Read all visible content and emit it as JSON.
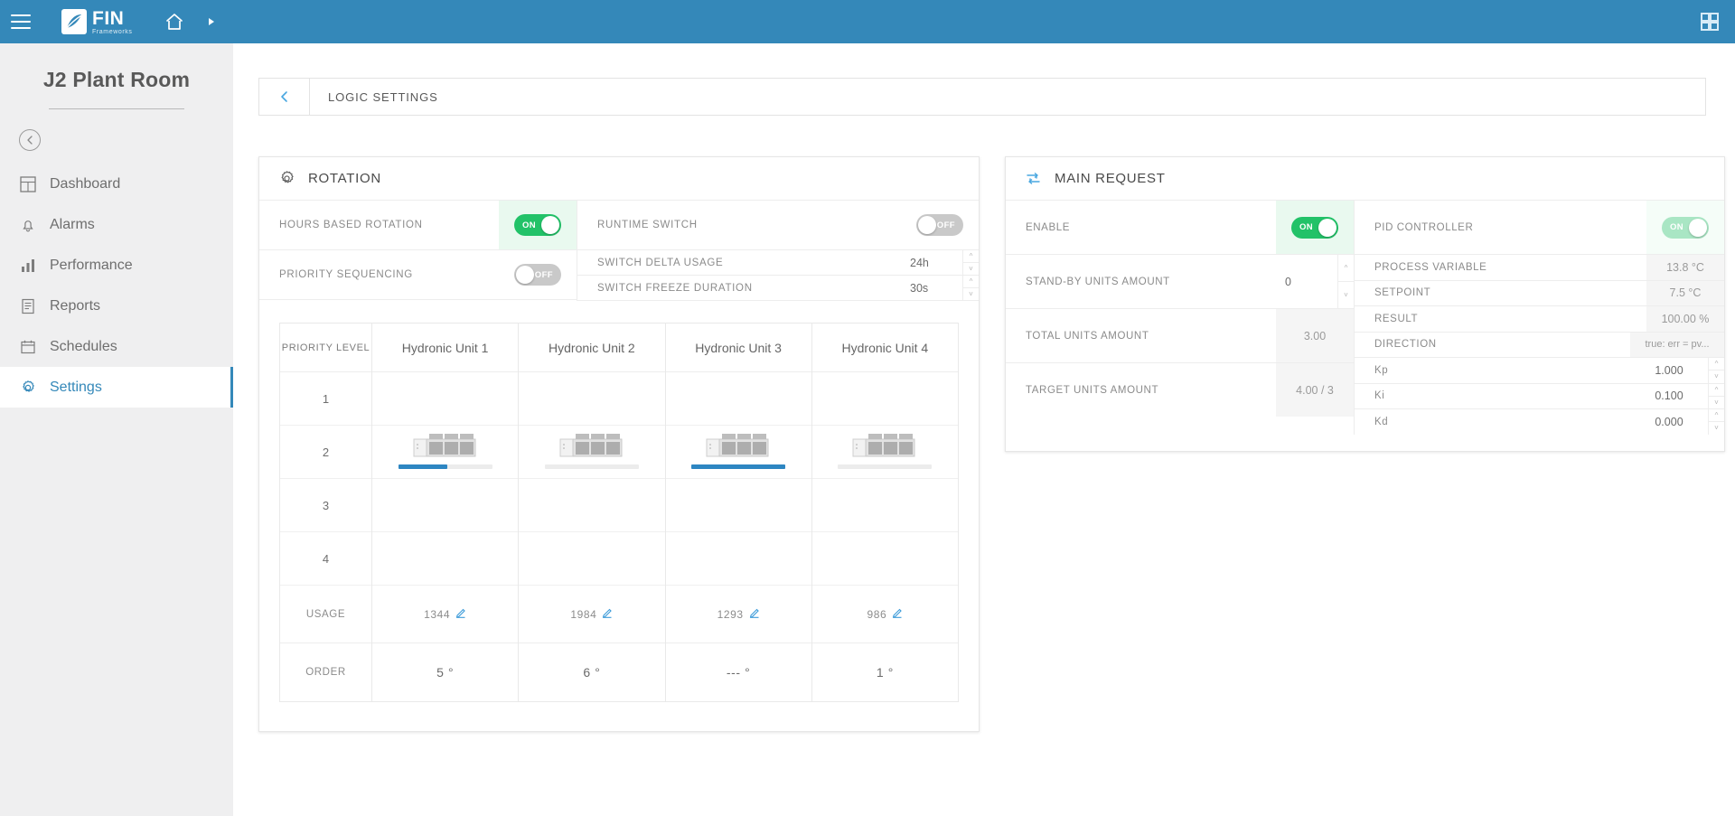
{
  "topbar": {
    "menu_icon": "hamburger-icon",
    "logo_main": "FIN",
    "logo_sub": "Frameworks",
    "home_icon": "home-icon",
    "crumb_icon": "caret-right-icon",
    "apps_icon": "grid-apps-icon"
  },
  "sidebar": {
    "site_title": "J2 Plant Room",
    "back_label": "back",
    "items": [
      {
        "label": "Dashboard",
        "icon": "dashboard-icon",
        "active": false
      },
      {
        "label": "Alarms",
        "icon": "bell-icon",
        "active": false
      },
      {
        "label": "Performance",
        "icon": "bar-chart-icon",
        "active": false
      },
      {
        "label": "Reports",
        "icon": "report-icon",
        "active": false
      },
      {
        "label": "Schedules",
        "icon": "calendar-icon",
        "active": false
      },
      {
        "label": "Settings",
        "icon": "gear-icon",
        "active": true
      }
    ]
  },
  "breadcrumb": {
    "title": "LOGIC SETTINGS",
    "back_icon": "arrow-left-icon"
  },
  "rotation": {
    "title": "ROTATION",
    "icon": "gear-icon",
    "left_rows": [
      {
        "label": "HOURS BASED ROTATION",
        "type": "toggle",
        "state": "ON",
        "highlight": true
      },
      {
        "label": "PRIORITY SEQUENCING",
        "type": "toggle",
        "state": "OFF",
        "highlight": false
      }
    ],
    "right_rows": [
      {
        "label": "RUNTIME SWITCH",
        "type": "toggle",
        "state": "OFF"
      },
      {
        "label": "SWITCH DELTA USAGE",
        "type": "number",
        "value": "24h"
      },
      {
        "label": "SWITCH FREEZE DURATION",
        "type": "number",
        "value": "30s"
      }
    ],
    "table": {
      "priority_header": "PRIORITY LEVEL",
      "usage_header": "USAGE",
      "order_header": "ORDER",
      "levels": [
        "1",
        "2",
        "3",
        "4"
      ],
      "units": [
        {
          "name": "Hydronic Unit 1",
          "usage": "1344",
          "order": "5 °",
          "bar_percent": 52,
          "icon": "chiller-unit-icon",
          "edit_icon": "pencil-icon"
        },
        {
          "name": "Hydronic Unit 2",
          "usage": "1984",
          "order": "6 °",
          "bar_percent": 0,
          "icon": "chiller-unit-icon",
          "edit_icon": "pencil-icon"
        },
        {
          "name": "Hydronic Unit 3",
          "usage": "1293",
          "order": "--- °",
          "bar_percent": 100,
          "icon": "chiller-unit-icon",
          "edit_icon": "pencil-icon"
        },
        {
          "name": "Hydronic Unit 4",
          "usage": "986",
          "order": "1 °",
          "bar_percent": 0,
          "icon": "chiller-unit-icon",
          "edit_icon": "pencil-icon"
        }
      ]
    }
  },
  "main_request": {
    "title": "MAIN REQUEST",
    "icon": "loop-refresh-icon",
    "left_rows": [
      {
        "label": "ENABLE",
        "type": "toggle",
        "state": "ON"
      },
      {
        "label": "STAND-BY UNITS AMOUNT",
        "type": "number",
        "value": "0"
      },
      {
        "label": "TOTAL UNITS AMOUNT",
        "type": "readonly",
        "value": "3.00"
      },
      {
        "label": "TARGET UNITS AMOUNT",
        "type": "readonly",
        "value": "4.00 / 3"
      }
    ],
    "right_rows": [
      {
        "label": "PID CONTROLLER",
        "type": "toggle",
        "state": "ON"
      },
      {
        "label": "PROCESS VARIABLE",
        "type": "readonly",
        "value": "13.8 °C"
      },
      {
        "label": "SETPOINT",
        "type": "readonly",
        "value": "7.5 °C"
      },
      {
        "label": "RESULT",
        "type": "readonly",
        "value": "100.00 %"
      },
      {
        "label": "DIRECTION",
        "type": "readonly",
        "value": "true: err = pv..."
      },
      {
        "label": "Kp",
        "type": "number",
        "value": "1.000"
      },
      {
        "label": "Ki",
        "type": "number",
        "value": "0.100"
      },
      {
        "label": "Kd",
        "type": "number",
        "value": "0.000"
      }
    ]
  },
  "colors": {
    "header_blue": "#3488b9",
    "accent_blue": "#2d86c2",
    "toggle_on": "#22c268",
    "toggle_off": "#c9c9c9",
    "toggle_on_faded": "#a9e6c4"
  }
}
